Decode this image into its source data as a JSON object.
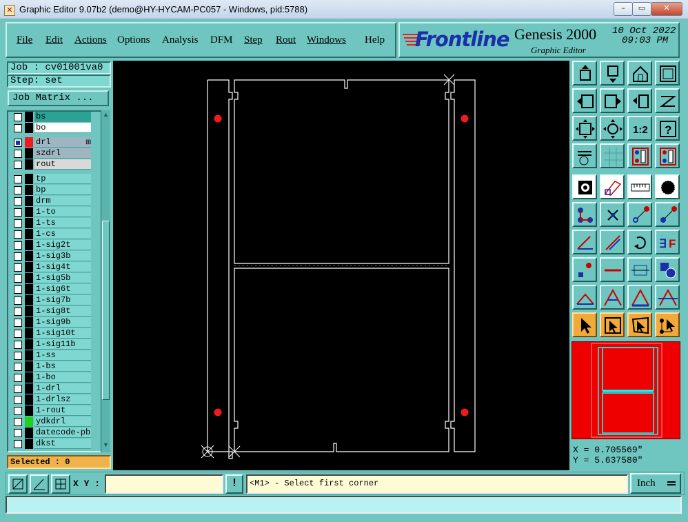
{
  "window": {
    "title": "Graphic Editor 9.07b2 (demo@HY-HYCAM-PC057 - Windows, pid:5788)",
    "minimize": "–",
    "restore": "▭",
    "close": "✕"
  },
  "menu": [
    {
      "label": "File",
      "underline": true
    },
    {
      "label": "Edit",
      "underline": true
    },
    {
      "label": "Actions",
      "underline": true
    },
    {
      "label": "Options",
      "underline": false
    },
    {
      "label": "Analysis",
      "underline": false
    },
    {
      "label": "DFM",
      "underline": false
    },
    {
      "label": "Step",
      "underline": true
    },
    {
      "label": "Rout",
      "underline": true
    },
    {
      "label": "Windows",
      "underline": true
    },
    {
      "label": "Help",
      "underline": false
    }
  ],
  "brand": {
    "logo": "Frontline",
    "product": "Genesis 2000",
    "subtitle": "Graphic Editor",
    "date": "10 Oct 2022",
    "time": "09:03 PM"
  },
  "job": {
    "label": "Job : cv01001va0",
    "step": "Step: set",
    "matrix_button": "Job Matrix ..."
  },
  "layers": [
    {
      "name": "bs",
      "color": "#000000",
      "bg": "#2aa395",
      "checked": false
    },
    {
      "name": "bo",
      "color": "#000000",
      "bg": "#ffffff",
      "checked": false
    },
    {
      "name": "drl",
      "color": "#ee1c1c",
      "bg": "#9fb6c2",
      "checked": true,
      "marker": "⊞"
    },
    {
      "name": "szdrl",
      "color": "#000000",
      "bg": "#9fb6c2",
      "checked": false
    },
    {
      "name": "rout",
      "color": "#000000",
      "bg": "#d9d9d9",
      "checked": false
    },
    {
      "name": "tp",
      "color": "#000000",
      "bg": "#7ed7d1",
      "checked": false
    },
    {
      "name": "bp",
      "color": "#000000",
      "bg": "#7ed7d1",
      "checked": false
    },
    {
      "name": "drm",
      "color": "#000000",
      "bg": "#7ed7d1",
      "checked": false
    },
    {
      "name": "1-to",
      "color": "#000000",
      "bg": "#7ed7d1",
      "checked": false
    },
    {
      "name": "1-ts",
      "color": "#000000",
      "bg": "#7ed7d1",
      "checked": false
    },
    {
      "name": "1-cs",
      "color": "#000000",
      "bg": "#7ed7d1",
      "checked": false
    },
    {
      "name": "1-sig2t",
      "color": "#000000",
      "bg": "#7ed7d1",
      "checked": false
    },
    {
      "name": "1-sig3b",
      "color": "#000000",
      "bg": "#7ed7d1",
      "checked": false
    },
    {
      "name": "1-sig4t",
      "color": "#000000",
      "bg": "#7ed7d1",
      "checked": false
    },
    {
      "name": "1-sig5b",
      "color": "#000000",
      "bg": "#7ed7d1",
      "checked": false
    },
    {
      "name": "1-sig6t",
      "color": "#000000",
      "bg": "#7ed7d1",
      "checked": false
    },
    {
      "name": "1-sig7b",
      "color": "#000000",
      "bg": "#7ed7d1",
      "checked": false
    },
    {
      "name": "1-sig8t",
      "color": "#000000",
      "bg": "#7ed7d1",
      "checked": false
    },
    {
      "name": "1-sig9b",
      "color": "#000000",
      "bg": "#7ed7d1",
      "checked": false
    },
    {
      "name": "1-sig10t",
      "color": "#000000",
      "bg": "#7ed7d1",
      "checked": false
    },
    {
      "name": "1-sig11b",
      "color": "#000000",
      "bg": "#7ed7d1",
      "checked": false
    },
    {
      "name": "1-ss",
      "color": "#000000",
      "bg": "#7ed7d1",
      "checked": false
    },
    {
      "name": "1-bs",
      "color": "#000000",
      "bg": "#7ed7d1",
      "checked": false
    },
    {
      "name": "1-bo",
      "color": "#000000",
      "bg": "#7ed7d1",
      "checked": false
    },
    {
      "name": "1-drl",
      "color": "#000000",
      "bg": "#7ed7d1",
      "checked": false
    },
    {
      "name": "1-drlsz",
      "color": "#000000",
      "bg": "#7ed7d1",
      "checked": false
    },
    {
      "name": "1-rout",
      "color": "#000000",
      "bg": "#7ed7d1",
      "checked": false
    },
    {
      "name": "ydkdrl",
      "color": "#1fd11f",
      "bg": "#7ed7d1",
      "checked": false
    },
    {
      "name": "datecode-pbo",
      "color": "#000000",
      "bg": "#7ed7d1",
      "checked": false
    },
    {
      "name": "dkst",
      "color": "#000000",
      "bg": "#7ed7d1",
      "checked": false
    }
  ],
  "selected": "Selected : 0",
  "coords": {
    "x": "X = 0.705569\"",
    "y": "Y = 5.637580\""
  },
  "bottom": {
    "xy_label": "X Y :",
    "xy_value": "",
    "prompt": "<M1> - Select first corner",
    "units": "Inch",
    "status": ""
  },
  "colors": {
    "canvas": "#000000",
    "panel": "#6fc5c0",
    "drill_pad": "#ee1c1c",
    "outline": "#ffffff",
    "overview": "#ee0000"
  },
  "toolbox_icons": [
    "move-up-icon",
    "move-down-icon",
    "home-icon",
    "window-icon",
    "pan-left-icon",
    "pan-right-icon",
    "undo-view-icon",
    "redraw-icon",
    "zoom-fit-icon",
    "zoom-center-icon",
    "zoom-1to1-icon",
    "help-icon",
    "settings-icon",
    "grid-icon",
    "layers-red-icon",
    "layers-blue-icon",
    "camera-icon",
    "profile-icon",
    "ruler-icon",
    "pad-icon",
    "connect-icon",
    "snap-center-icon",
    "line-point-icon",
    "arrow-point-icon",
    "angle-icon",
    "slash-line-icon",
    "rotate-icon",
    "mirror-icon",
    "feature-select-icon",
    "horizontal-line-icon",
    "measure-icon",
    "overlap-icon",
    "arc-small-icon",
    "arc-point-icon",
    "arc-full-icon",
    "arc-cross-icon",
    "pointer-icon",
    "pointer-box-icon",
    "pointer-area-icon",
    "pointer-net-icon"
  ]
}
